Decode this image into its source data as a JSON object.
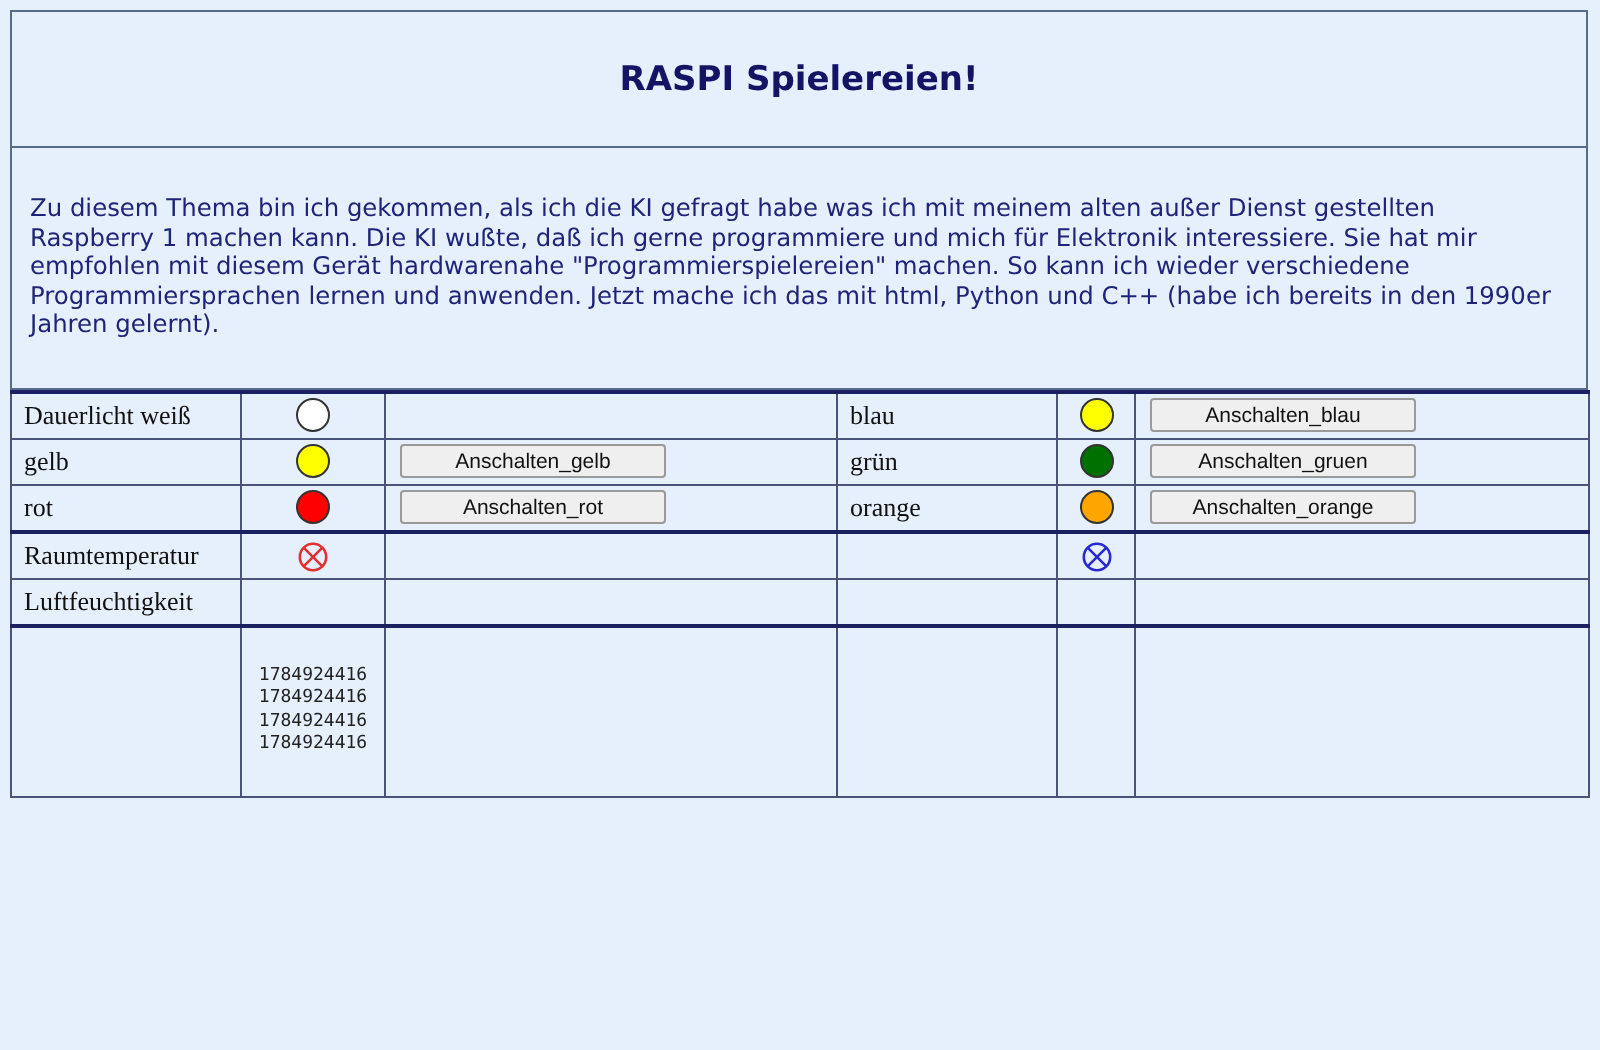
{
  "title": "RASPI Spielereien!",
  "intro": "Zu diesem Thema bin ich gekommen, als ich die KI gefragt habe was ich mit meinem alten außer Dienst gestellten Raspberry 1 machen kann. Die KI wußte, daß ich gerne programmiere und mich für Elektronik interessiere. Sie hat mir empfohlen mit diesem Gerät hardwarenahe \"Programmierspielereien\" machen. So kann ich wieder verschiedene Programmiersprachen lernen und anwenden. Jetzt mache ich das mit html, Python und C++ (habe ich bereits in den 1990er Jahren gelernt).",
  "groups": [
    [
      {
        "cells": [
          {
            "kind": "label",
            "text": "Dauerlicht weiß"
          },
          {
            "kind": "lamp",
            "color": "#ffffff"
          },
          {
            "kind": "empty"
          },
          {
            "kind": "label",
            "text": "blau"
          },
          {
            "kind": "lamp",
            "color": "#ffff00"
          },
          {
            "kind": "button",
            "text": "Anschalten_blau"
          }
        ]
      },
      {
        "cells": [
          {
            "kind": "label",
            "text": "gelb"
          },
          {
            "kind": "lamp",
            "color": "#ffff00"
          },
          {
            "kind": "button",
            "text": "Anschalten_gelb"
          },
          {
            "kind": "label",
            "text": "grün"
          },
          {
            "kind": "lamp",
            "color": "#007000"
          },
          {
            "kind": "button",
            "text": "Anschalten_gruen"
          }
        ]
      },
      {
        "cells": [
          {
            "kind": "label",
            "text": "rot"
          },
          {
            "kind": "lamp",
            "color": "#ff0000"
          },
          {
            "kind": "button",
            "text": "Anschalten_rot"
          },
          {
            "kind": "label",
            "text": "orange"
          },
          {
            "kind": "lamp",
            "color": "#ffa500"
          },
          {
            "kind": "button",
            "text": "Anschalten_orange"
          }
        ]
      }
    ],
    [
      {
        "cells": [
          {
            "kind": "label",
            "text": "Raumtemperatur"
          },
          {
            "kind": "sensor",
            "color": "#e03030"
          },
          {
            "kind": "empty"
          },
          {
            "kind": "empty"
          },
          {
            "kind": "sensor",
            "color": "#2828d0"
          },
          {
            "kind": "empty"
          }
        ]
      },
      {
        "cells": [
          {
            "kind": "label",
            "text": "Luftfeuchtigkeit"
          },
          {
            "kind": "empty"
          },
          {
            "kind": "empty"
          },
          {
            "kind": "empty"
          },
          {
            "kind": "empty"
          },
          {
            "kind": "empty"
          }
        ]
      }
    ],
    [
      {
        "tall": true,
        "cells": [
          {
            "kind": "empty"
          },
          {
            "kind": "lines",
            "lines": [
              "1784924416",
              "1784924416",
              "1784924416",
              "1784924416"
            ]
          },
          {
            "kind": "empty"
          },
          {
            "kind": "empty"
          },
          {
            "kind": "empty"
          },
          {
            "kind": "empty"
          }
        ]
      }
    ]
  ]
}
